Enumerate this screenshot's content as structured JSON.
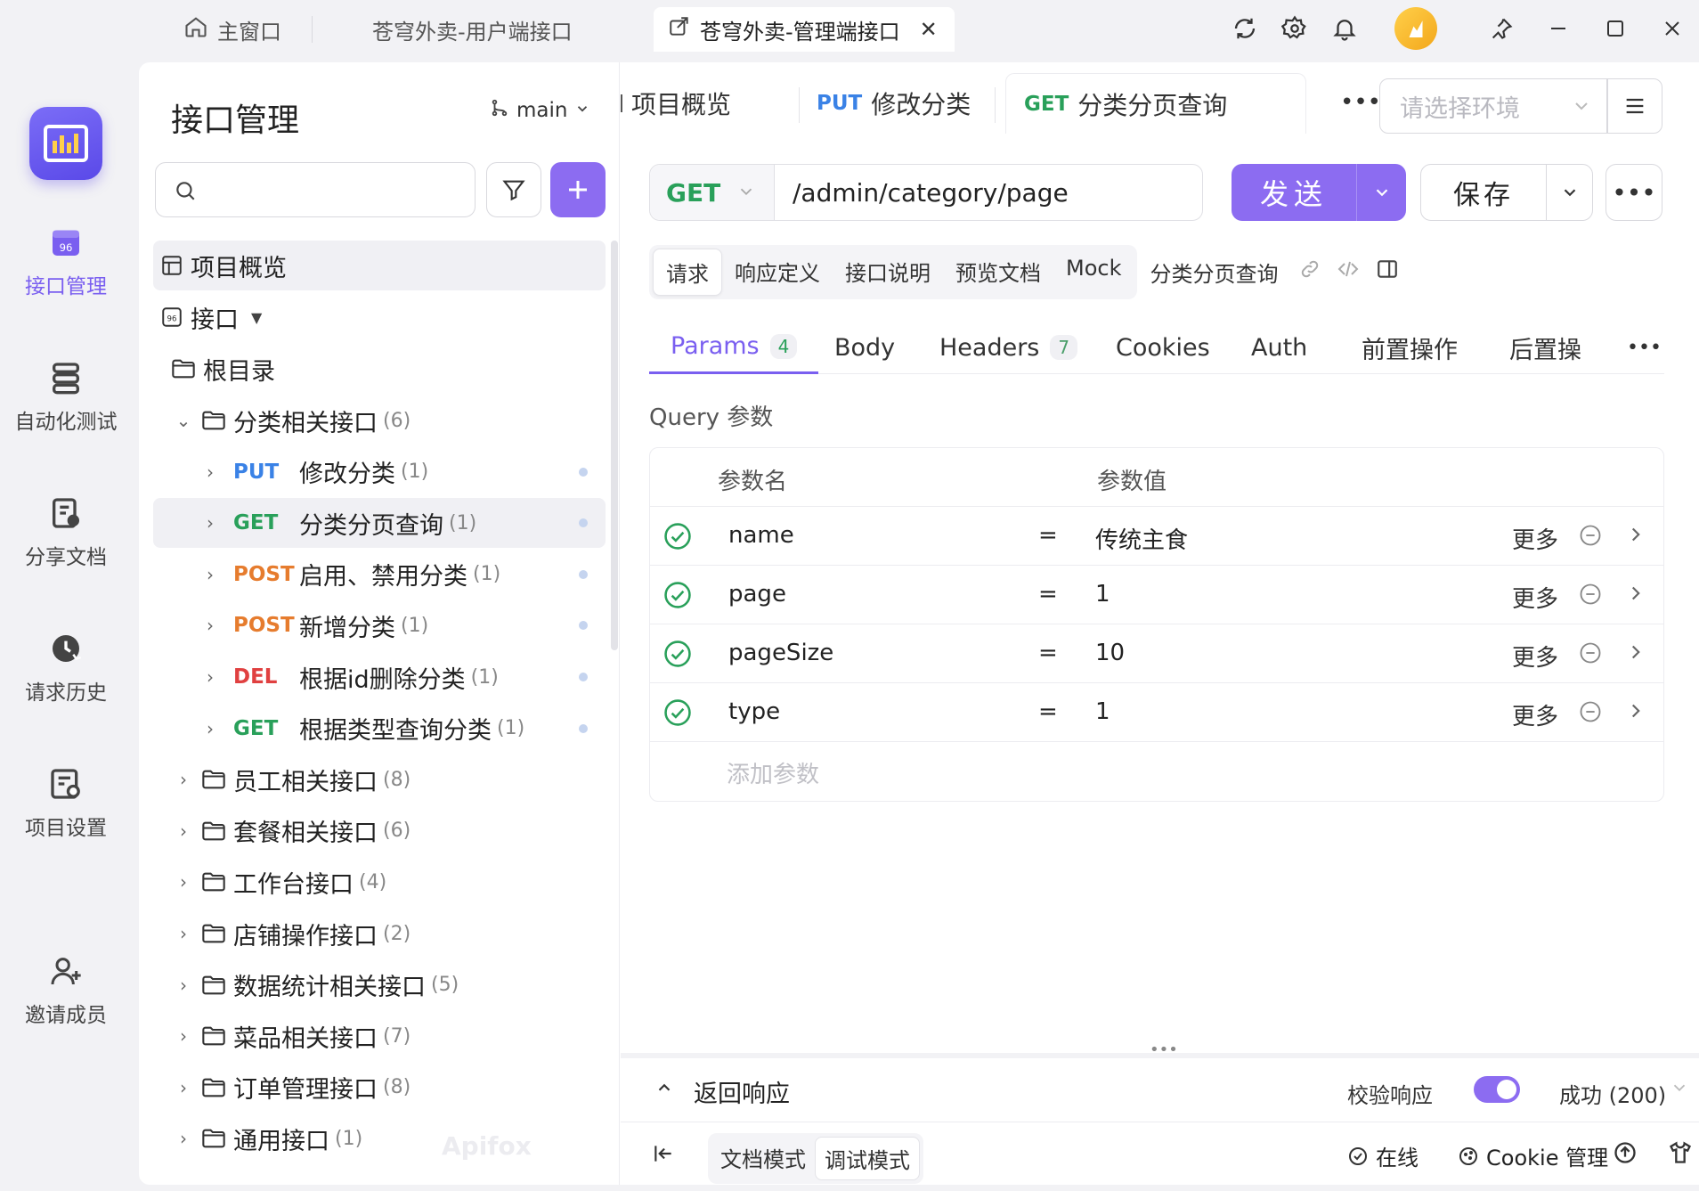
{
  "titlebar": {
    "tabs": [
      {
        "label": "主窗口",
        "icon": "home-icon"
      },
      {
        "label": "苍穹外卖-用户端接口"
      },
      {
        "label": "苍穹外卖-管理端接口",
        "icon": "external-link-icon",
        "active": true
      }
    ]
  },
  "rail": {
    "items": [
      {
        "label": "接口管理",
        "active": true
      },
      {
        "label": "自动化测试"
      },
      {
        "label": "分享文档"
      },
      {
        "label": "请求历史"
      },
      {
        "label": "项目设置"
      },
      {
        "label": "邀请成员"
      }
    ]
  },
  "sidebar": {
    "title": "接口管理",
    "branch": "main",
    "overview": "项目概览",
    "interfaces": "接口",
    "root": "根目录",
    "watermark": "Apifox",
    "tree": [
      {
        "type": "folder",
        "label": "分类相关接口",
        "count": "(6)",
        "expanded": true
      },
      {
        "type": "api",
        "method": "PUT",
        "label": "修改分类",
        "count": "(1)"
      },
      {
        "type": "api",
        "method": "GET",
        "label": "分类分页查询",
        "count": "(1)",
        "selected": true
      },
      {
        "type": "api",
        "method": "POST",
        "label": "启用、禁用分类",
        "count": "(1)"
      },
      {
        "type": "api",
        "method": "POST",
        "label": "新增分类",
        "count": "(1)"
      },
      {
        "type": "api",
        "method": "DEL",
        "label": "根据id删除分类",
        "count": "(1)"
      },
      {
        "type": "api",
        "method": "GET",
        "label": "根据类型查询分类",
        "count": "(1)"
      },
      {
        "type": "folder",
        "label": "员工相关接口",
        "count": "(8)"
      },
      {
        "type": "folder",
        "label": "套餐相关接口",
        "count": "(6)"
      },
      {
        "type": "folder",
        "label": "工作台接口",
        "count": "(4)"
      },
      {
        "type": "folder",
        "label": "店铺操作接口",
        "count": "(2)"
      },
      {
        "type": "folder",
        "label": "数据统计相关接口",
        "count": "(5)"
      },
      {
        "type": "folder",
        "label": "菜品相关接口",
        "count": "(7)"
      },
      {
        "type": "folder",
        "label": "订单管理接口",
        "count": "(8)"
      },
      {
        "type": "folder",
        "label": "通用接口",
        "count": "(1)"
      }
    ]
  },
  "editor": {
    "tabs": [
      {
        "method": "",
        "label": "项目概览"
      },
      {
        "method": "PUT",
        "label": "修改分类"
      },
      {
        "method": "GET",
        "label": "分类分页查询",
        "active": true
      }
    ],
    "env_placeholder": "请选择环境",
    "method": "GET",
    "url": "/admin/category/page",
    "send_label": "发送",
    "save_label": "保存",
    "subtabs": [
      "请求",
      "响应定义",
      "接口说明",
      "预览文档",
      "Mock"
    ],
    "subtab_title": "分类分页查询",
    "param_tabs": [
      {
        "label": "Params",
        "badge": "4",
        "active": true
      },
      {
        "label": "Body"
      },
      {
        "label": "Headers",
        "badge": "7"
      },
      {
        "label": "Cookies"
      },
      {
        "label": "Auth"
      },
      {
        "label": "前置操作"
      },
      {
        "label": "后置操"
      }
    ],
    "query_label": "Query 参数",
    "columns": {
      "name": "参数名",
      "value": "参数值"
    },
    "params": [
      {
        "name": "name",
        "value": "传统主食"
      },
      {
        "name": "page",
        "value": "1"
      },
      {
        "name": "pageSize",
        "value": "10"
      },
      {
        "name": "type",
        "value": "1"
      }
    ],
    "more_label": "更多",
    "add_param": "添加参数"
  },
  "response": {
    "title": "返回响应",
    "validate_label": "校验响应",
    "status": "成功 (200)"
  },
  "footer": {
    "modes": [
      "文档模式",
      "调试模式"
    ],
    "online": "在线",
    "cookie": "Cookie 管理"
  },
  "colors": {
    "accent": "#8c6cf1",
    "get": "#29a05a",
    "put": "#3a82e6",
    "post": "#e67c2e",
    "del": "#e04040"
  }
}
